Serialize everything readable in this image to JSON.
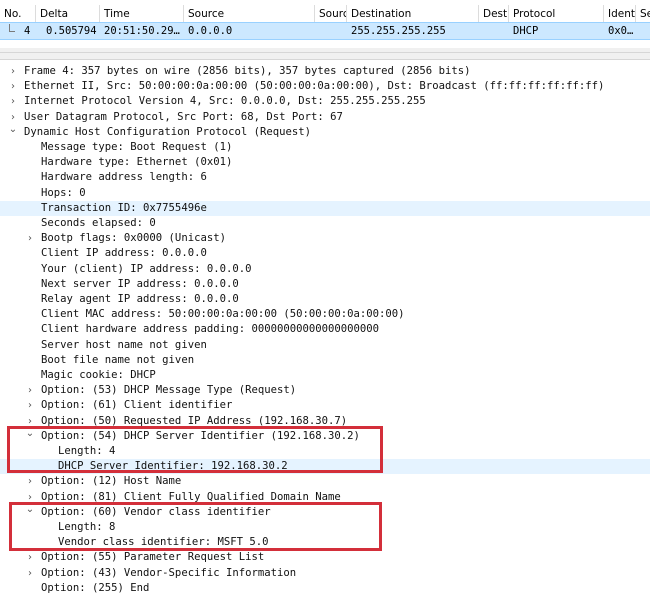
{
  "packet_list": {
    "columns": [
      "No.",
      "Delta",
      "Time",
      "Source",
      "Sourc",
      "Destination",
      "Destir",
      "Protocol",
      "Identi",
      "Se"
    ],
    "row": {
      "no": "4",
      "delta": "0.505794",
      "time": "20:51:50.29…",
      "source": "0.0.0.0",
      "destination": "255.255.255.255",
      "protocol": "DHCP",
      "identi": "0x0…"
    }
  },
  "tree": [
    {
      "text": "Frame 4: 357 bytes on wire (2856 bits), 357 bytes captured (2856 bits)",
      "toggle": "collapsed",
      "level": 0
    },
    {
      "text": "Ethernet II, Src: 50:00:00:0a:00:00 (50:00:00:0a:00:00), Dst: Broadcast (ff:ff:ff:ff:ff:ff)",
      "toggle": "collapsed",
      "level": 0
    },
    {
      "text": "Internet Protocol Version 4, Src: 0.0.0.0, Dst: 255.255.255.255",
      "toggle": "collapsed",
      "level": 0
    },
    {
      "text": "User Datagram Protocol, Src Port: 68, Dst Port: 67",
      "toggle": "collapsed",
      "level": 0
    },
    {
      "text": "Dynamic Host Configuration Protocol (Request)",
      "toggle": "expanded",
      "level": 0
    },
    {
      "text": "Message type: Boot Request (1)",
      "toggle": "none",
      "level": 1
    },
    {
      "text": "Hardware type: Ethernet (0x01)",
      "toggle": "none",
      "level": 1
    },
    {
      "text": "Hardware address length: 6",
      "toggle": "none",
      "level": 1
    },
    {
      "text": "Hops: 0",
      "toggle": "none",
      "level": 1
    },
    {
      "text": "Transaction ID: 0x7755496e",
      "toggle": "none",
      "level": 1,
      "selected": true
    },
    {
      "text": "Seconds elapsed: 0",
      "toggle": "none",
      "level": 1
    },
    {
      "text": "Bootp flags: 0x0000 (Unicast)",
      "toggle": "collapsed",
      "level": 1
    },
    {
      "text": "Client IP address: 0.0.0.0",
      "toggle": "none",
      "level": 1
    },
    {
      "text": "Your (client) IP address: 0.0.0.0",
      "toggle": "none",
      "level": 1
    },
    {
      "text": "Next server IP address: 0.0.0.0",
      "toggle": "none",
      "level": 1
    },
    {
      "text": "Relay agent IP address: 0.0.0.0",
      "toggle": "none",
      "level": 1
    },
    {
      "text": "Client MAC address: 50:00:00:0a:00:00 (50:00:00:0a:00:00)",
      "toggle": "none",
      "level": 1
    },
    {
      "text": "Client hardware address padding: 00000000000000000000",
      "toggle": "none",
      "level": 1
    },
    {
      "text": "Server host name not given",
      "toggle": "none",
      "level": 1
    },
    {
      "text": "Boot file name not given",
      "toggle": "none",
      "level": 1
    },
    {
      "text": "Magic cookie: DHCP",
      "toggle": "none",
      "level": 1
    },
    {
      "text": "Option: (53) DHCP Message Type (Request)",
      "toggle": "collapsed",
      "level": 1
    },
    {
      "text": "Option: (61) Client identifier",
      "toggle": "collapsed",
      "level": 1
    },
    {
      "text": "Option: (50) Requested IP Address (192.168.30.7)",
      "toggle": "collapsed",
      "level": 1
    },
    {
      "text": "Option: (54) DHCP Server Identifier (192.168.30.2)",
      "toggle": "expanded",
      "level": 1
    },
    {
      "text": "Length: 4",
      "toggle": "none",
      "level": 2
    },
    {
      "text": "DHCP Server Identifier: 192.168.30.2",
      "toggle": "none",
      "level": 2,
      "selected": true
    },
    {
      "text": "Option: (12) Host Name",
      "toggle": "collapsed",
      "level": 1
    },
    {
      "text": "Option: (81) Client Fully Qualified Domain Name",
      "toggle": "collapsed",
      "level": 1
    },
    {
      "text": "Option: (60) Vendor class identifier",
      "toggle": "expanded",
      "level": 1
    },
    {
      "text": "Length: 8",
      "toggle": "none",
      "level": 2
    },
    {
      "text": "Vendor class identifier: MSFT 5.0",
      "toggle": "none",
      "level": 2
    },
    {
      "text": "Option: (55) Parameter Request List",
      "toggle": "collapsed",
      "level": 1
    },
    {
      "text": "Option: (43) Vendor-Specific Information",
      "toggle": "collapsed",
      "level": 1
    },
    {
      "text": "Option: (255) End",
      "toggle": "none",
      "level": 1
    }
  ],
  "colors": {
    "selected_row": "#cce8ff",
    "highlighted_field": "#e5f3ff",
    "callout_border": "#d32f3a"
  },
  "icons": {
    "collapsed": "chevron-right-icon",
    "expanded": "chevron-down-icon"
  }
}
